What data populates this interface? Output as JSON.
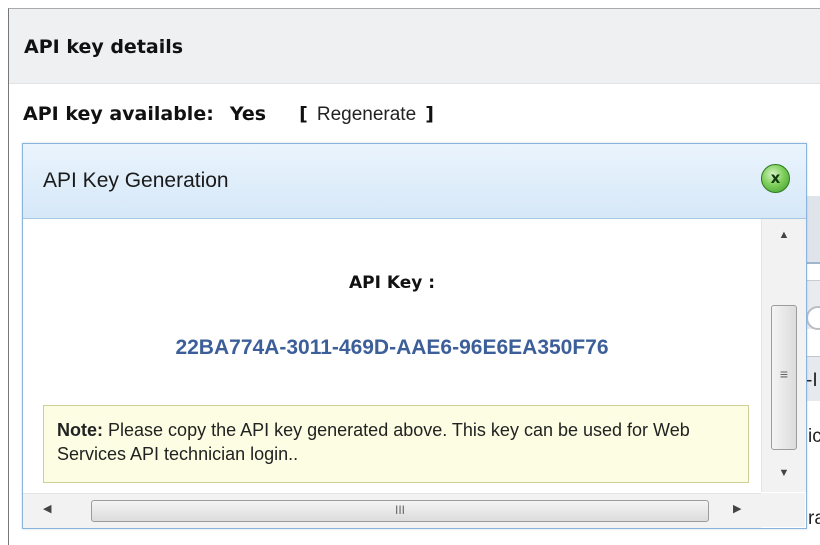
{
  "page": {
    "section_title": "API key details",
    "status_label": "API key available:",
    "status_value": "Yes",
    "bracket_open": "[",
    "regenerate_link": "Regenerate",
    "bracket_close": "]",
    "background_fragments": [
      "-I",
      "ic",
      "ra"
    ]
  },
  "dialog": {
    "title": "API Key Generation",
    "close_symbol": "x",
    "key_caption": "API Key :",
    "key_value": "22BA774A-3011-469D-AAE6-96E6EA350F76",
    "note_label": "Note:",
    "note_text": "Please copy the API key generated above. This key can be used for Web Services API technician login..",
    "scrollbar": {
      "up": "▲",
      "down": "▼",
      "left": "◀",
      "right": "▶",
      "v_grip": "≡",
      "h_grip": "III"
    }
  },
  "colors": {
    "key_value": "#3c5f9a",
    "note_background": "#fdfde3",
    "dialog_border": "#8ab4dc",
    "close_button": "#5fb843"
  },
  "icons": {
    "close": "close-icon"
  }
}
